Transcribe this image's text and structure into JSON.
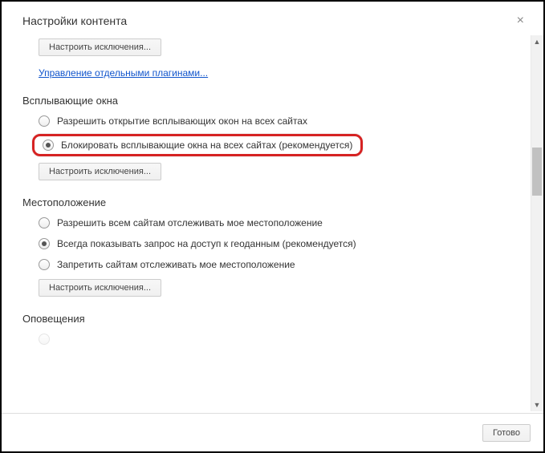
{
  "dialog": {
    "title": "Настройки контента",
    "close": "×",
    "done_button": "Готово"
  },
  "top": {
    "exceptions_button": "Настроить исключения...",
    "manage_plugins_link": "Управление отдельными плагинами..."
  },
  "popups": {
    "title": "Всплывающие окна",
    "allow_label": "Разрешить открытие всплывающих окон на всех сайтах",
    "block_label": "Блокировать всплывающие окна на всех сайтах (рекомендуется)",
    "exceptions_button": "Настроить исключения...",
    "selected": "block"
  },
  "location": {
    "title": "Местоположение",
    "allow_label": "Разрешить всем сайтам отслеживать мое местоположение",
    "ask_label": "Всегда показывать запрос на доступ к геоданным (рекомендуется)",
    "deny_label": "Запретить сайтам отслеживать мое местоположение",
    "exceptions_button": "Настроить исключения...",
    "selected": "ask"
  },
  "notifications": {
    "title": "Оповещения"
  }
}
